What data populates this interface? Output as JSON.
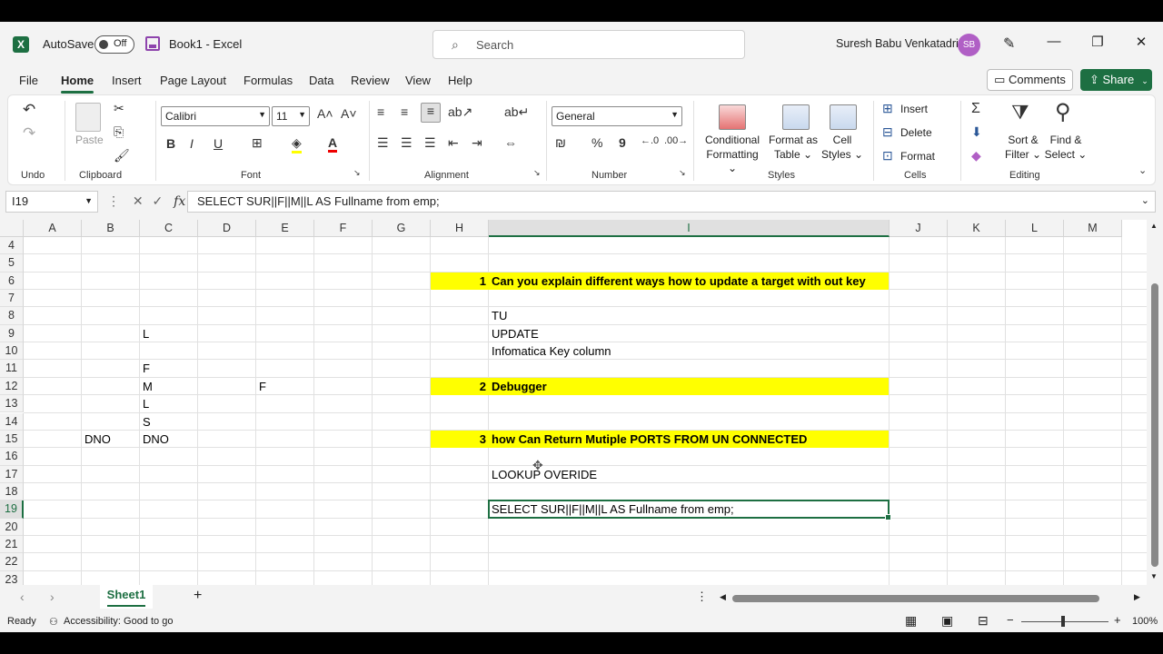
{
  "titlebar": {
    "autosave_label": "AutoSave",
    "autosave_state": "Off",
    "doc_title": "Book1  -  Excel",
    "search_placeholder": "Search",
    "user_name": "Suresh Babu Venkatadri",
    "user_initials": "SB"
  },
  "menu": {
    "tabs": [
      "File",
      "Home",
      "Insert",
      "Page Layout",
      "Formulas",
      "Data",
      "Review",
      "View",
      "Help"
    ],
    "active_tab": "Home",
    "comments": "Comments",
    "share": "Share"
  },
  "ribbon": {
    "undo": "Undo",
    "paste": "Paste",
    "clipboard": "Clipboard",
    "font_name": "Calibri",
    "font_size": "11",
    "font": "Font",
    "bold": "B",
    "italic": "I",
    "underline": "U",
    "alignment": "Alignment",
    "number_format": "General",
    "number": "Number",
    "percent": "%",
    "comma": "9",
    "conditional_formatting_1": "Conditional",
    "conditional_formatting_2": "Formatting ⌄",
    "format_as_table_1": "Format as",
    "format_as_table_2": "Table ⌄",
    "cell_styles_1": "Cell",
    "cell_styles_2": "Styles ⌄",
    "styles": "Styles",
    "insert": "Insert",
    "delete": "Delete",
    "format": "Format",
    "cells": "Cells",
    "sort_filter_1": "Sort &",
    "sort_filter_2": "Filter ⌄",
    "find_select_1": "Find &",
    "find_select_2": "Select ⌄",
    "editing": "Editing"
  },
  "formula_bar": {
    "name_box": "I19",
    "fx": "fx",
    "formula": "SELECT SUR||F||M||L AS Fullname from emp;"
  },
  "grid": {
    "columns": [
      "A",
      "B",
      "C",
      "D",
      "E",
      "F",
      "G",
      "H",
      "I",
      "J",
      "K",
      "L",
      "M"
    ],
    "selected_column": "I",
    "rows": [
      "4",
      "5",
      "6",
      "7",
      "8",
      "9",
      "10",
      "11",
      "12",
      "13",
      "14",
      "15",
      "16",
      "17",
      "18",
      "19",
      "20",
      "21",
      "22",
      "23"
    ],
    "selected_row": "19",
    "cells": {
      "H6": "1",
      "I6": "Can you explain different ways how to update a target with out key",
      "I8": "TU",
      "C9": "L",
      "I9": "UPDATE",
      "I10": "Infomatica Key column",
      "C11": "F",
      "C12": "M",
      "E12": "F",
      "H12": "2",
      "I12": "Debugger",
      "C13": "L",
      "C14": "S",
      "B15": "DNO",
      "C15": "DNO",
      "H15": "3",
      "I15": "how Can Return Mutiple PORTS FROM UN CONNECTED",
      "I17": "LOOKUP OVERIDE",
      "I19": "SELECT SUR||F||M||L AS Fullname from emp;"
    },
    "highlight_color": "#ffff00"
  },
  "sheets": {
    "active": "Sheet1",
    "add": "+"
  },
  "status": {
    "ready": "Ready",
    "accessibility": "Accessibility: Good to go",
    "zoom": "100%"
  },
  "colors": {
    "accent": "#1d6f42",
    "avatar": "#b05fc5"
  }
}
